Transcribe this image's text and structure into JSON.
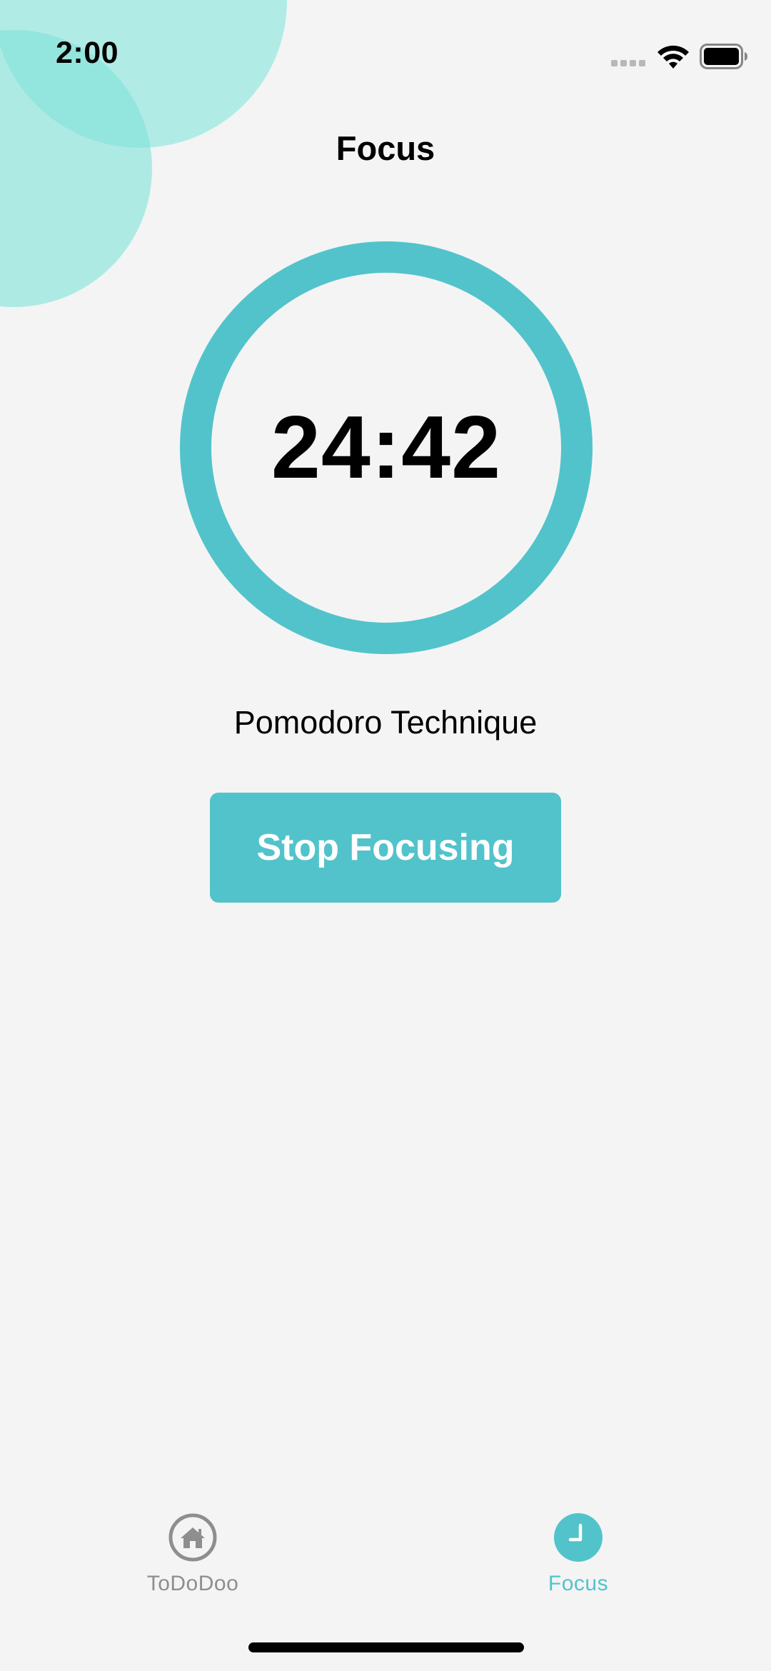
{
  "status_bar": {
    "time": "2:00"
  },
  "header": {
    "title": "Focus"
  },
  "timer": {
    "value": "24:42",
    "ring_color": "#52c3cb"
  },
  "technique": {
    "label": "Pomodoro Technique"
  },
  "actions": {
    "stop_label": "Stop Focusing"
  },
  "tab_bar": {
    "tabs": [
      {
        "label": "ToDoDoo",
        "icon": "home-icon",
        "active": false
      },
      {
        "label": "Focus",
        "icon": "clock-icon",
        "active": true
      }
    ]
  },
  "colors": {
    "accent": "#52c3cb",
    "background": "#f4f4f4",
    "inactive": "#8e8e8e",
    "bubble": "#9ee8e0"
  }
}
